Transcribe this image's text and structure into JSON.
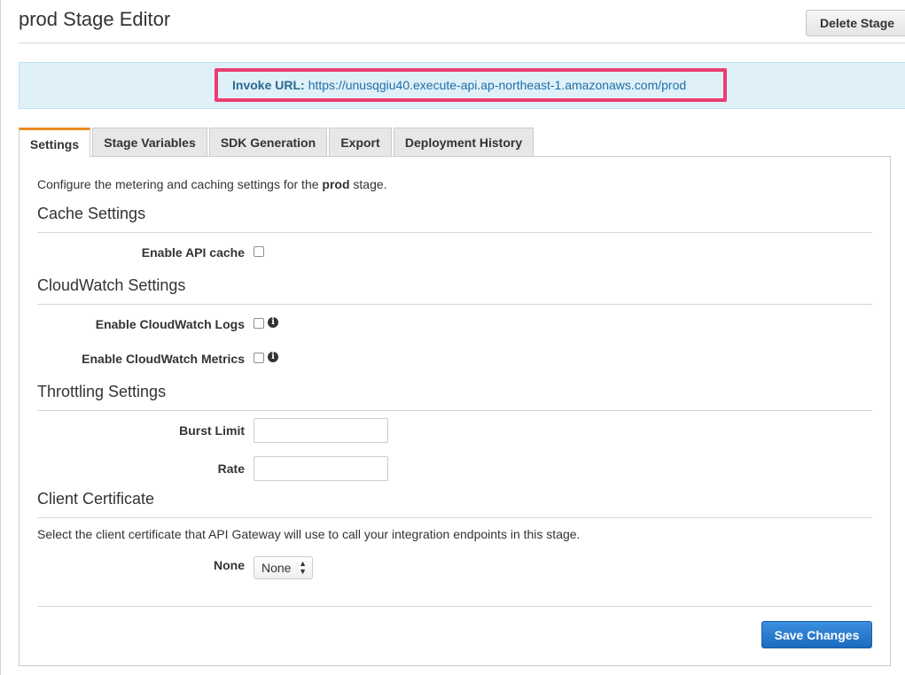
{
  "header": {
    "title": "prod Stage Editor",
    "delete_label": "Delete Stage"
  },
  "invoke": {
    "label": "Invoke URL:",
    "url": "https://unusqgiu40.execute-api.ap-northeast-1.amazonaws.com/prod",
    "highlight_color": "#ea3d71"
  },
  "tabs": [
    {
      "label": "Settings",
      "active": true
    },
    {
      "label": "Stage Variables",
      "active": false
    },
    {
      "label": "SDK Generation",
      "active": false
    },
    {
      "label": "Export",
      "active": false
    },
    {
      "label": "Deployment History",
      "active": false
    }
  ],
  "intro": {
    "prefix": "Configure the metering and caching settings for the ",
    "stage_name": "prod",
    "suffix": " stage."
  },
  "cache": {
    "heading": "Cache Settings",
    "enable_label": "Enable API cache",
    "enabled": false
  },
  "cloudwatch": {
    "heading": "CloudWatch Settings",
    "logs_label": "Enable CloudWatch Logs",
    "logs_enabled": false,
    "metrics_label": "Enable CloudWatch Metrics",
    "metrics_enabled": false,
    "info_icon": "info-circle-icon"
  },
  "throttling": {
    "heading": "Throttling Settings",
    "burst_label": "Burst Limit",
    "burst_value": "",
    "rate_label": "Rate",
    "rate_value": ""
  },
  "certificate": {
    "heading": "Client Certificate",
    "description": "Select the client certificate that API Gateway will use to call your integration endpoints in this stage.",
    "field_label": "None",
    "selected": "None"
  },
  "footer": {
    "save_label": "Save Changes",
    "accent": "#1b6ac0"
  }
}
